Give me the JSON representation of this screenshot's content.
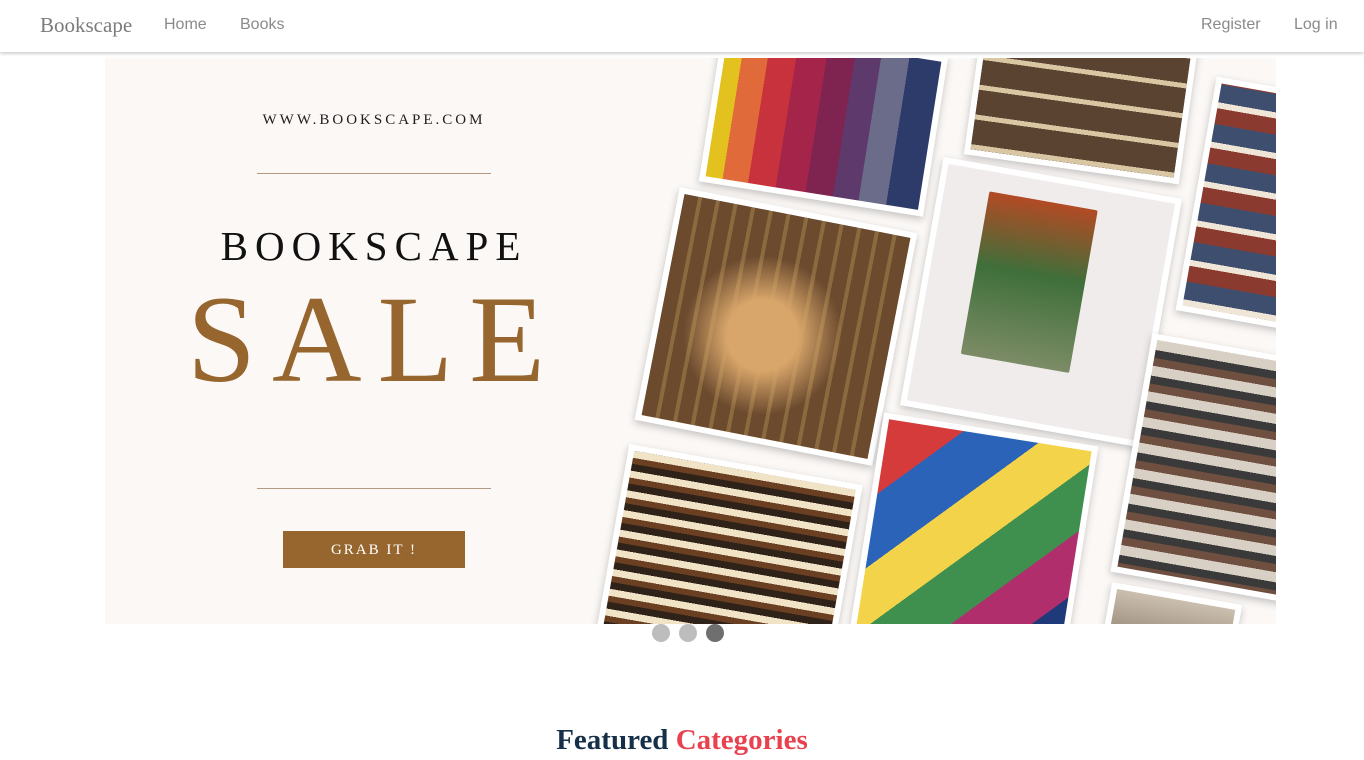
{
  "navbar": {
    "brand": "Bookscape",
    "links": [
      "Home",
      "Books"
    ],
    "right_links": [
      "Register",
      "Log in"
    ]
  },
  "banner": {
    "url": "WWW.BOOKSCAPE.COM",
    "brand": "BOOKSCAPE",
    "headline": "SALE",
    "button": "GRAB IT !",
    "photos": [
      "colorful-book-spines",
      "library-shelves",
      "bookstore-interior",
      "harry-potter-book",
      "library-aisle",
      "stacked-old-books",
      "bookshop-table",
      "book-piles"
    ]
  },
  "carousel": {
    "slides": 3,
    "active": 3
  },
  "featured": {
    "word1": "Featured",
    "word2": "Categories"
  },
  "colors": {
    "accent": "#96662e",
    "heading_dark": "#16304a",
    "heading_red": "#e8424f"
  }
}
